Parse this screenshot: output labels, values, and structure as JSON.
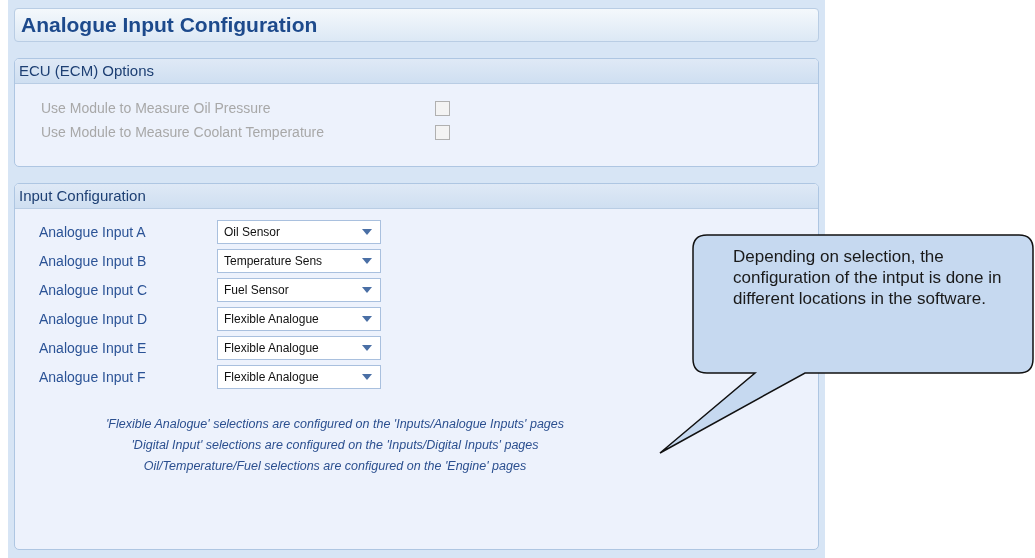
{
  "title": "Analogue Input Configuration",
  "ecu_options": {
    "heading": "ECU (ECM) Options",
    "items": [
      {
        "label": "Use Module to Measure Oil Pressure",
        "checked": false,
        "disabled": true
      },
      {
        "label": "Use Module to Measure Coolant Temperature",
        "checked": false,
        "disabled": true
      }
    ]
  },
  "input_configuration": {
    "heading": "Input Configuration",
    "inputs": [
      {
        "label": "Analogue Input A",
        "value": "Oil Sensor"
      },
      {
        "label": "Analogue Input B",
        "value": "Temperature Sens"
      },
      {
        "label": "Analogue Input C",
        "value": "Fuel Sensor"
      },
      {
        "label": "Analogue Input D",
        "value": "Flexible Analogue"
      },
      {
        "label": "Analogue Input E",
        "value": "Flexible Analogue"
      },
      {
        "label": "Analogue Input F",
        "value": "Flexible Analogue"
      }
    ],
    "notes": [
      "'Flexible Analogue' selections are configured on the 'Inputs/Analogue Inputs' pages",
      "'Digital Input' selections are configured on the 'Inputs/Digital Inputs' pages",
      "Oil/Temperature/Fuel selections are configured on the 'Engine' pages"
    ]
  },
  "callout": {
    "text": "Depending on selection, the configuration of the intput is done in different locations in the software."
  }
}
